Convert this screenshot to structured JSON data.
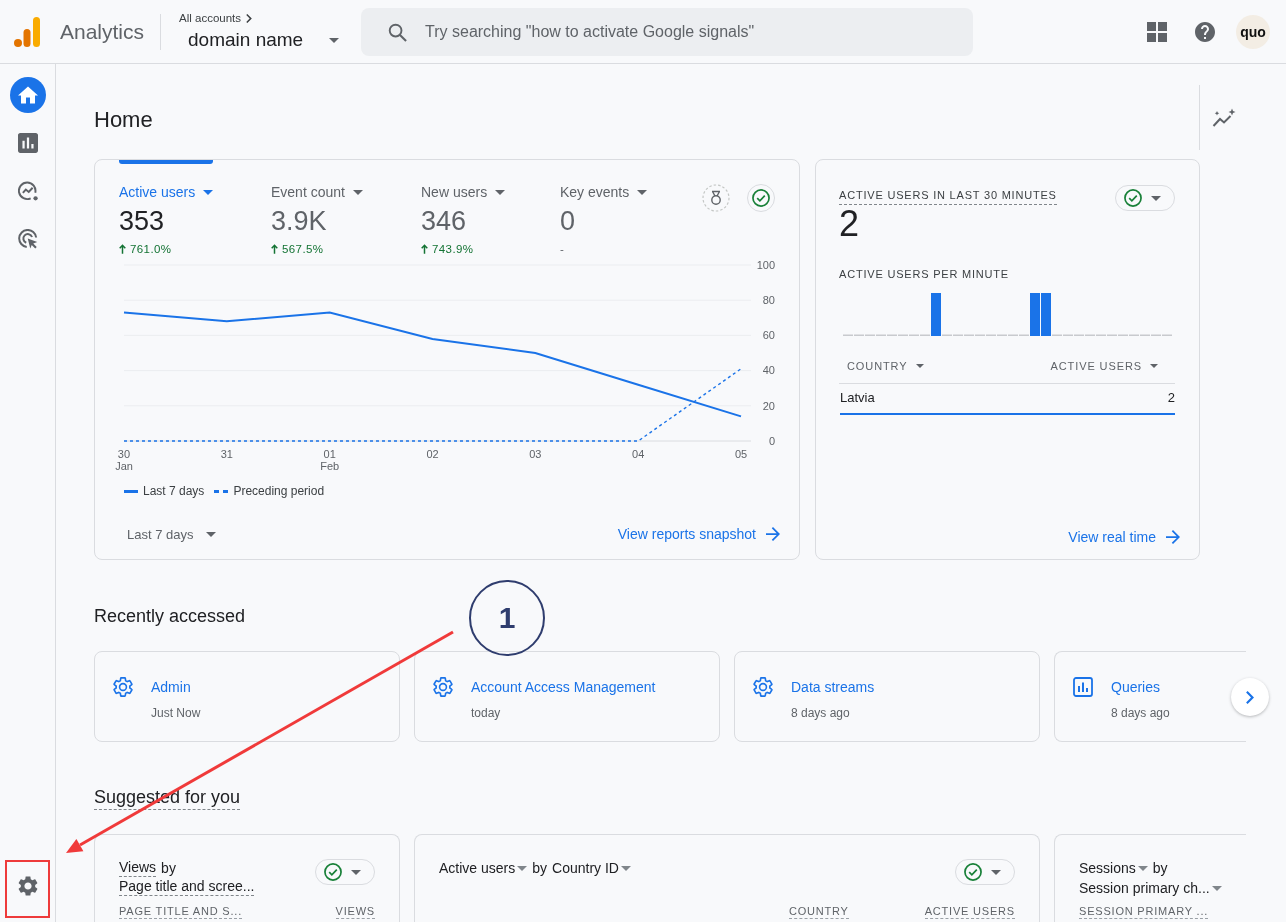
{
  "header": {
    "product": "Analytics",
    "account_path": "All accounts",
    "property": "domain name",
    "search": {
      "placeholder": "Try searching \"how to activate Google signals\""
    },
    "avatar": "quo"
  },
  "nav": [
    {
      "selected": true
    },
    {
      "selected": false
    },
    {
      "selected": false
    },
    {
      "selected": false
    }
  ],
  "page_title": "Home",
  "overview": {
    "metrics": [
      {
        "label": "Active users",
        "value": "353",
        "change": "761.0%",
        "up": true,
        "selected": true
      },
      {
        "label": "Event count",
        "value": "3.9K",
        "change": "567.5%",
        "up": true,
        "selected": false
      },
      {
        "label": "New users",
        "value": "346",
        "change": "743.9%",
        "up": true,
        "selected": false
      },
      {
        "label": "Key events",
        "value": "0",
        "change": "-",
        "up": false,
        "selected": false
      }
    ],
    "check": true,
    "chart_data": {
      "type": "line",
      "categories": [
        "30 Jan",
        "31",
        "01 Feb",
        "02",
        "03",
        "04",
        "05"
      ],
      "series": [
        {
          "name": "Last 7 days",
          "color": "#1a73e8",
          "line_style": "solid",
          "values": [
            73,
            68,
            73,
            58,
            50,
            32,
            14
          ]
        },
        {
          "name": "Preceding period",
          "color": "#1a73e8",
          "line_style": "dashed",
          "values": [
            0,
            0,
            0,
            0,
            0,
            0,
            41
          ]
        }
      ],
      "ylim": [
        0,
        100
      ],
      "yticks": [
        0,
        20,
        40,
        60,
        80,
        100
      ],
      "grid": true,
      "legend": "bottom"
    },
    "date_range": "Last 7 days",
    "link": "View reports snapshot"
  },
  "realtime": {
    "title": "ACTIVE USERS IN LAST 30 MINUTES",
    "check": true,
    "value": "2",
    "chart_title": "ACTIVE USERS PER MINUTE",
    "table": {
      "columns": [
        "COUNTRY",
        "ACTIVE USERS"
      ],
      "rows": [
        {
          "cells": [
            "Latvia",
            "2"
          ]
        }
      ]
    },
    "link": "View real time"
  },
  "recently_accessed": {
    "title": "Recently accessed",
    "items": [
      {
        "kind": "settings",
        "name": "Admin",
        "time": "Just Now"
      },
      {
        "kind": "settings",
        "name": "Account Access Management",
        "time": "today"
      },
      {
        "kind": "settings",
        "name": "Data streams",
        "time": "8 days ago"
      },
      {
        "kind": "report",
        "name": "Queries",
        "time": "8 days ago"
      }
    ]
  },
  "suggested": {
    "title": "Suggested for you",
    "cards": [
      {
        "kind": "table",
        "metric": "Views",
        "metric_menu": false,
        "connector": "by",
        "dimension": "Page title and scree...",
        "dimension_menu": false,
        "check": true,
        "columns": [
          "PAGE TITLE AND S...",
          "VIEWS"
        ]
      },
      {
        "kind": "map_table",
        "metric": "Active users",
        "metric_menu": true,
        "connector": "by",
        "dimension": "Country ID",
        "dimension_menu": true,
        "check": true,
        "columns": [
          "COUNTRY",
          "ACTIVE USERS"
        ]
      },
      {
        "kind": "table",
        "metric": "Sessions",
        "metric_menu": true,
        "connector": "by",
        "dimension": "Session primary ch...",
        "dimension_menu": true,
        "columns": [
          "SESSION PRIMARY ..."
        ]
      }
    ]
  },
  "annotation": {
    "step": "1"
  }
}
